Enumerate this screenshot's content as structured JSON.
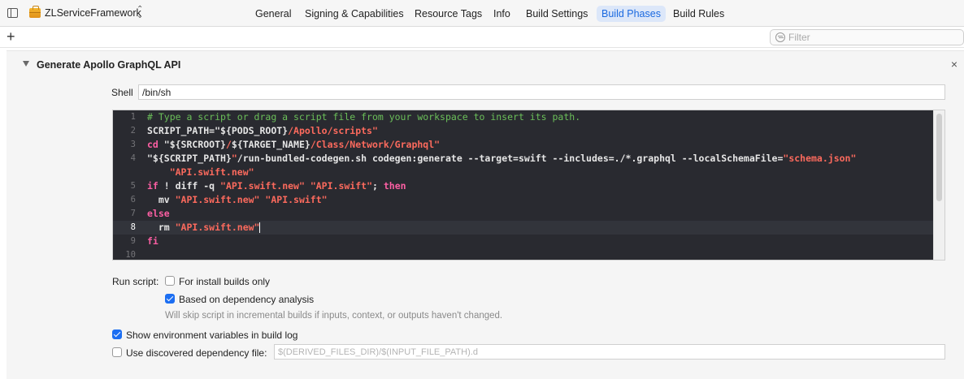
{
  "header": {
    "target_name": "ZLServiceFramework",
    "tabs": [
      {
        "label": "General"
      },
      {
        "label": "Signing & Capabilities"
      },
      {
        "label": "Resource Tags"
      },
      {
        "label": "Info"
      },
      {
        "label": "Build Settings"
      },
      {
        "label": "Build Phases",
        "active": true
      },
      {
        "label": "Build Rules"
      }
    ]
  },
  "toolbar": {
    "add_label": "+",
    "filter_placeholder": "Filter"
  },
  "phase": {
    "title": "Generate Apollo GraphQL API",
    "close_label": "×",
    "shell_label": "Shell",
    "shell_value": "/bin/sh",
    "code_lines": [
      {
        "num": "1",
        "segments": [
          {
            "t": "# Type a script or drag a script file from your workspace to insert its path.",
            "c": "comment"
          }
        ]
      },
      {
        "num": "2",
        "segments": [
          {
            "t": "SCRIPT_PATH=",
            "c": "plain"
          },
          {
            "t": "\"${PODS_ROOT}",
            "c": "plain"
          },
          {
            "t": "/Apollo/scripts\"",
            "c": "str"
          }
        ]
      },
      {
        "num": "3",
        "segments": [
          {
            "t": "cd ",
            "c": "kw"
          },
          {
            "t": "\"${SRCROOT}",
            "c": "plain"
          },
          {
            "t": "/",
            "c": "str"
          },
          {
            "t": "${TARGET_NAME}",
            "c": "plain"
          },
          {
            "t": "/Class/Network/Graphql\"",
            "c": "str"
          }
        ]
      },
      {
        "num": "4",
        "segments": [
          {
            "t": "\"${SCRIPT_PATH}",
            "c": "plain"
          },
          {
            "t": "\"",
            "c": "str"
          },
          {
            "t": "/run-bundled-codegen.sh codegen:generate --target=swift --includes=./*.graphql --localSchemaFile=",
            "c": "plain"
          },
          {
            "t": "\"schema.json\"",
            "c": "str"
          }
        ]
      },
      {
        "num": "",
        "segments": [
          {
            "t": "    \"API.swift.new\"",
            "c": "str"
          }
        ]
      },
      {
        "num": "5",
        "segments": [
          {
            "t": "if",
            "c": "kw"
          },
          {
            "t": " ! diff -q ",
            "c": "plain"
          },
          {
            "t": "\"API.swift.new\"",
            "c": "str"
          },
          {
            "t": " ",
            "c": "plain"
          },
          {
            "t": "\"API.swift\"",
            "c": "str"
          },
          {
            "t": "; ",
            "c": "plain"
          },
          {
            "t": "then",
            "c": "kw"
          }
        ]
      },
      {
        "num": "6",
        "segments": [
          {
            "t": "  mv ",
            "c": "plain"
          },
          {
            "t": "\"API.swift.new\"",
            "c": "str"
          },
          {
            "t": " ",
            "c": "plain"
          },
          {
            "t": "\"API.swift\"",
            "c": "str"
          }
        ]
      },
      {
        "num": "7",
        "segments": [
          {
            "t": "else",
            "c": "kw"
          }
        ]
      },
      {
        "num": "8",
        "current": true,
        "segments": [
          {
            "t": "  rm ",
            "c": "plain"
          },
          {
            "t": "\"API.swift.new\"",
            "c": "str"
          }
        ]
      },
      {
        "num": "9",
        "segments": [
          {
            "t": "fi",
            "c": "kw"
          }
        ]
      },
      {
        "num": "10",
        "segments": []
      }
    ],
    "run_script_label": "Run script:",
    "install_builds_label": "For install builds only",
    "install_builds_checked": false,
    "dependency_label": "Based on dependency analysis",
    "dependency_checked": true,
    "dependency_hint": "Will skip script in incremental builds if inputs, context, or outputs haven't changed.",
    "env_vars_label": "Show environment variables in build log",
    "env_vars_checked": true,
    "dep_file_label": "Use discovered dependency file:",
    "dep_file_checked": false,
    "dep_file_placeholder": "$(DERIVED_FILES_DIR)/$(INPUT_FILE_PATH).d"
  }
}
